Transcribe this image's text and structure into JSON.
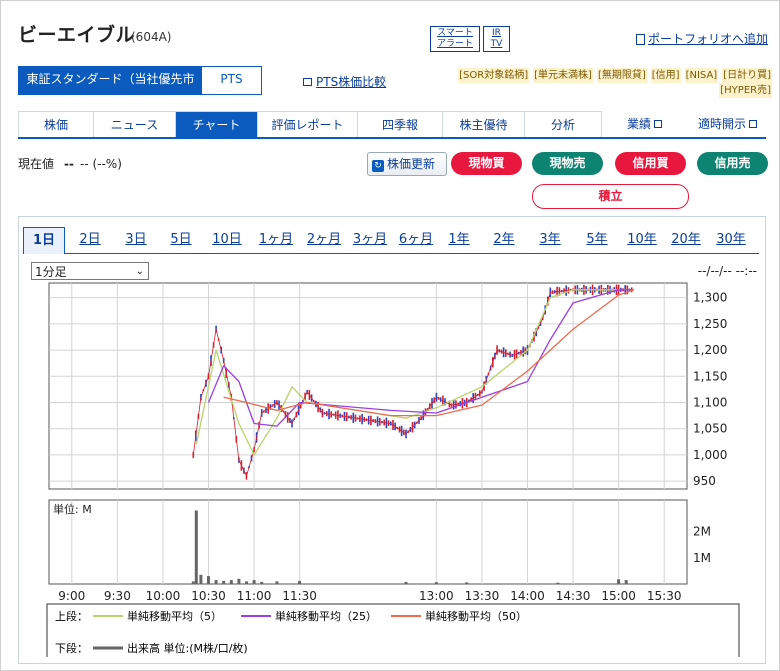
{
  "header": {
    "title": "ビーエイブル",
    "code": "(604A)",
    "alert_line1": "スマート",
    "alert_line2": "アラート",
    "irtv_line1": "IR",
    "irtv_line2": "TV",
    "portfolio": "ポートフォリオへ追加"
  },
  "market_tabs": [
    {
      "label": "東証スタンダード（当社優先市場）"
    },
    {
      "label": "PTS"
    }
  ],
  "pts_compare": "PTS株価比較",
  "badges": [
    "[SOR対象銘柄]",
    "[単元未満株]",
    "[無期限貸]",
    "[信用]",
    "[NISA]",
    "[日計り買]",
    "[HYPER売]"
  ],
  "nav": [
    {
      "label": "株価"
    },
    {
      "label": "ニュース"
    },
    {
      "label": "チャート"
    },
    {
      "label": "評価レポート"
    },
    {
      "label": "四季報"
    },
    {
      "label": "株主優待"
    },
    {
      "label": "分析"
    },
    {
      "label": "業績"
    },
    {
      "label": "適時開示"
    }
  ],
  "price": {
    "label": "現在値",
    "value": "--",
    "change": "-- (--%)"
  },
  "buttons": {
    "refresh": "株価更新",
    "buy_spot": "現物買",
    "sell_spot": "現物売",
    "buy_margin": "信用買",
    "sell_margin": "信用売",
    "tsumitate": "積立"
  },
  "periods": [
    "1日",
    "2日",
    "3日",
    "5日",
    "10日",
    "1ヶ月",
    "2ヶ月",
    "3ヶ月",
    "6ヶ月",
    "1年",
    "2年",
    "3年",
    "5年",
    "10年",
    "20年",
    "30年"
  ],
  "interval": "1分足",
  "datetime": "--/--/-- --:--",
  "chart_data": [
    {
      "type": "line",
      "name": "price",
      "x": [
        "9:00",
        "9:30",
        "10:00",
        "10:30",
        "11:00",
        "11:30",
        "13:00",
        "13:30",
        "14:00",
        "14:30",
        "15:00",
        "15:30"
      ],
      "ylim": [
        950,
        1320
      ],
      "yticks": [
        "1,300",
        "1,250",
        "1,200",
        "1,150",
        "1,100",
        "1,050",
        "1,000",
        "950"
      ],
      "grid": true,
      "series": [
        {
          "name": "price",
          "points": [
            [
              "10:20",
              1000
            ],
            [
              "10:25",
              1110
            ],
            [
              "10:30",
              1150
            ],
            [
              "10:35",
              1240
            ],
            [
              "10:40",
              1180
            ],
            [
              "10:45",
              1110
            ],
            [
              "10:50",
              990
            ],
            [
              "10:55",
              960
            ],
            [
              "11:00",
              1010
            ],
            [
              "11:05",
              1080
            ],
            [
              "11:15",
              1100
            ],
            [
              "11:25",
              1060
            ],
            [
              "11:35",
              1120
            ],
            [
              "11:45",
              1080
            ],
            [
              "12:30",
              1060
            ],
            [
              "12:40",
              1040
            ],
            [
              "12:50",
              1070
            ],
            [
              "13:00",
              1110
            ],
            [
              "13:10",
              1095
            ],
            [
              "13:20",
              1100
            ],
            [
              "13:30",
              1120
            ],
            [
              "13:40",
              1200
            ],
            [
              "13:50",
              1190
            ],
            [
              "14:00",
              1200
            ],
            [
              "14:10",
              1260
            ],
            [
              "14:15",
              1310
            ],
            [
              "14:30",
              1315
            ],
            [
              "15:00",
              1315
            ],
            [
              "15:10",
              1315
            ]
          ]
        },
        {
          "name": "単純移動平均（5）",
          "points": [
            [
              "10:22",
              1020
            ],
            [
              "10:35",
              1200
            ],
            [
              "10:50",
              1060
            ],
            [
              "11:00",
              1000
            ],
            [
              "11:15",
              1070
            ],
            [
              "11:25",
              1130
            ],
            [
              "11:35",
              1100
            ],
            [
              "12:40",
              1070
            ],
            [
              "13:00",
              1090
            ],
            [
              "13:30",
              1130
            ],
            [
              "14:00",
              1200
            ],
            [
              "14:15",
              1300
            ],
            [
              "14:30",
              1315
            ],
            [
              "15:10",
              1315
            ]
          ]
        },
        {
          "name": "単純移動平均（25）",
          "points": [
            [
              "10:30",
              1100
            ],
            [
              "10:40",
              1170
            ],
            [
              "10:50",
              1140
            ],
            [
              "11:00",
              1060
            ],
            [
              "11:15",
              1055
            ],
            [
              "11:30",
              1100
            ],
            [
              "12:30",
              1085
            ],
            [
              "13:00",
              1080
            ],
            [
              "13:30",
              1110
            ],
            [
              "14:00",
              1140
            ],
            [
              "14:15",
              1220
            ],
            [
              "14:30",
              1290
            ],
            [
              "15:00",
              1315
            ],
            [
              "15:10",
              1315
            ]
          ]
        },
        {
          "name": "単純移動平均（50）",
          "points": [
            [
              "10:40",
              1110
            ],
            [
              "10:55",
              1100
            ],
            [
              "11:15",
              1085
            ],
            [
              "11:35",
              1100
            ],
            [
              "12:30",
              1075
            ],
            [
              "13:00",
              1075
            ],
            [
              "13:30",
              1095
            ],
            [
              "14:00",
              1160
            ],
            [
              "14:30",
              1240
            ],
            [
              "15:00",
              1305
            ],
            [
              "15:10",
              1315
            ]
          ]
        }
      ]
    },
    {
      "type": "bar",
      "name": "出来高",
      "unit_label": "単位: M",
      "yticks": [
        "2M",
        "1M"
      ],
      "categories": [
        "10:20",
        "10:22",
        "10:25",
        "10:30",
        "10:35",
        "10:40",
        "10:45",
        "10:50",
        "10:55",
        "11:00",
        "11:05",
        "11:15",
        "11:30",
        "12:40",
        "13:00",
        "13:20",
        "14:20",
        "15:00",
        "15:05"
      ],
      "values": [
        0.1,
        2.8,
        0.35,
        0.3,
        0.15,
        0.12,
        0.15,
        0.2,
        0.1,
        0.15,
        0.08,
        0.1,
        0.12,
        0.08,
        0.07,
        0.06,
        0.05,
        0.18,
        0.15
      ]
    }
  ],
  "legend": {
    "upper_label": "上段：",
    "lower_label": "下段：",
    "sma5": "単純移動平均（5）",
    "sma25": "単純移動平均（25）",
    "sma50": "単純移動平均（50）",
    "volume": "出来高 単位:(M株/口/枚)",
    "sma5_color": "#b7d56b",
    "sma25_color": "#9b3fe0",
    "sma50_color": "#ee6b4d",
    "volume_color": "#666666"
  }
}
